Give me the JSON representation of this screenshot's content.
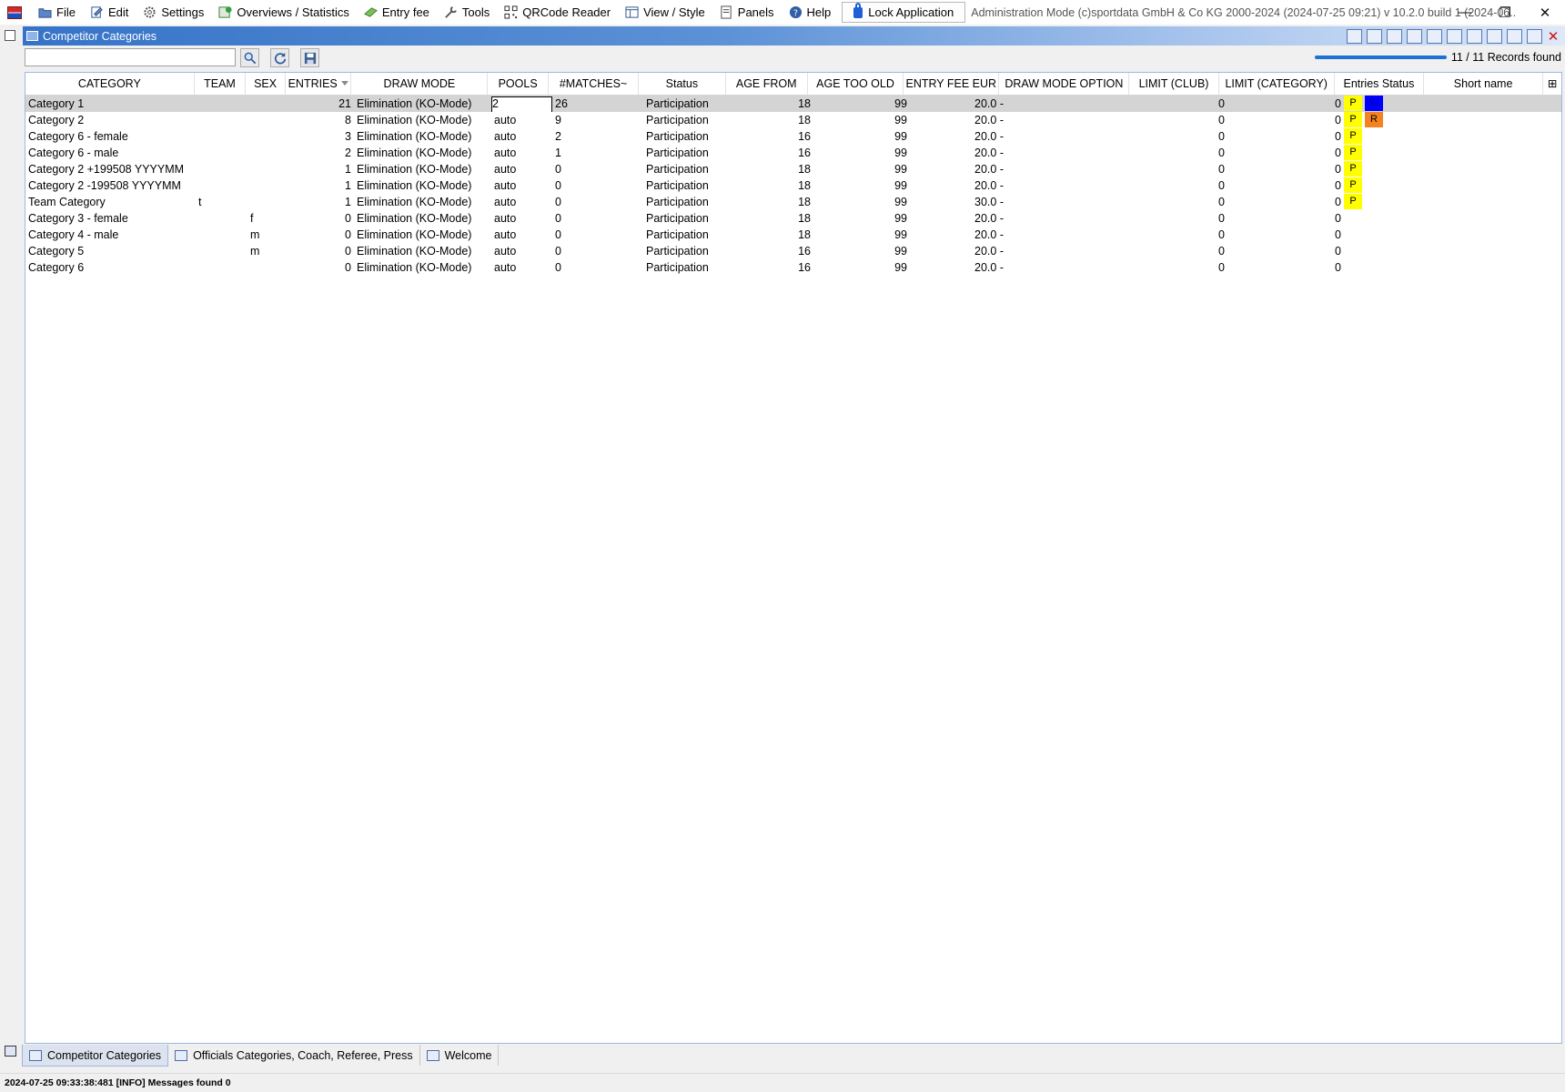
{
  "menubar": {
    "items": [
      {
        "label": "File",
        "icon": "folder-icon"
      },
      {
        "label": "Edit",
        "icon": "edit-icon"
      },
      {
        "label": "Settings",
        "icon": "gear-icon"
      },
      {
        "label": "Overviews / Statistics",
        "icon": "statistics-icon"
      },
      {
        "label": "Entry fee",
        "icon": "money-icon"
      },
      {
        "label": "Tools",
        "icon": "wrench-icon"
      },
      {
        "label": "QRCode Reader",
        "icon": "qrcode-icon"
      },
      {
        "label": "View / Style",
        "icon": "view-icon"
      },
      {
        "label": "Panels",
        "icon": "panels-icon"
      },
      {
        "label": "Help",
        "icon": "help-icon"
      }
    ],
    "lock_label": "Lock Application",
    "title": "Administration Mode (c)sportdata GmbH & Co KG 2000-2024 (2024-07-25 09:21)  v 10.2.0 build 1 (2024-06..."
  },
  "window_controls": {
    "minimize": "—",
    "restore": "❐",
    "close": "✕"
  },
  "panel": {
    "title": "Competitor Categories"
  },
  "toolbar": {
    "search_value": "",
    "progress_percent": 100,
    "records_found": "11 / 11 Records found"
  },
  "colors": {
    "yellow": "#ffff00",
    "blue": "#0000ff",
    "orange": "#f58220",
    "header_blue": "#3673c8"
  },
  "table": {
    "columns": [
      "CATEGORY",
      "TEAM",
      "SEX",
      "ENTRIES",
      "DRAW MODE",
      "POOLS",
      "#MATCHES~",
      "Status",
      "AGE FROM",
      "AGE TOO OLD",
      "ENTRY FEE EUR",
      "DRAW MODE OPTION",
      "LIMIT (CLUB)",
      "LIMIT (CATEGORY)",
      "Entries Status",
      "Short name"
    ],
    "rows": [
      {
        "category": "Category 1",
        "team": "",
        "sex": "",
        "entries": "21",
        "draw_mode": "Elimination (KO-Mode)",
        "pools": "2",
        "matches": "26",
        "status": "Participation",
        "age_from": "18",
        "age_too_old": "99",
        "entry_fee": "20.0 -",
        "draw_mode_option": "",
        "limit_club": "0",
        "limit_category": "0",
        "entries_status": [
          "P",
          "W"
        ],
        "short_name": ""
      },
      {
        "category": "Category 2",
        "team": "",
        "sex": "",
        "entries": "8",
        "draw_mode": "Elimination (KO-Mode)",
        "pools": "auto",
        "matches": "9",
        "status": "Participation",
        "age_from": "18",
        "age_too_old": "99",
        "entry_fee": "20.0 -",
        "draw_mode_option": "",
        "limit_club": "0",
        "limit_category": "0",
        "entries_status": [
          "P",
          "R"
        ],
        "short_name": ""
      },
      {
        "category": "Category 6 - female",
        "team": "",
        "sex": "",
        "entries": "3",
        "draw_mode": "Elimination (KO-Mode)",
        "pools": "auto",
        "matches": "2",
        "status": "Participation",
        "age_from": "16",
        "age_too_old": "99",
        "entry_fee": "20.0 -",
        "draw_mode_option": "",
        "limit_club": "0",
        "limit_category": "0",
        "entries_status": [
          "P"
        ],
        "short_name": ""
      },
      {
        "category": "Category 6 - male",
        "team": "",
        "sex": "",
        "entries": "2",
        "draw_mode": "Elimination (KO-Mode)",
        "pools": "auto",
        "matches": "1",
        "status": "Participation",
        "age_from": "16",
        "age_too_old": "99",
        "entry_fee": "20.0 -",
        "draw_mode_option": "",
        "limit_club": "0",
        "limit_category": "0",
        "entries_status": [
          "P"
        ],
        "short_name": ""
      },
      {
        "category": "Category 2 +199508 YYYYMM",
        "team": "",
        "sex": "",
        "entries": "1",
        "draw_mode": "Elimination (KO-Mode)",
        "pools": "auto",
        "matches": "0",
        "status": "Participation",
        "age_from": "18",
        "age_too_old": "99",
        "entry_fee": "20.0 -",
        "draw_mode_option": "",
        "limit_club": "0",
        "limit_category": "0",
        "entries_status": [
          "P"
        ],
        "short_name": ""
      },
      {
        "category": "Category 2 -199508 YYYYMM",
        "team": "",
        "sex": "",
        "entries": "1",
        "draw_mode": "Elimination (KO-Mode)",
        "pools": "auto",
        "matches": "0",
        "status": "Participation",
        "age_from": "18",
        "age_too_old": "99",
        "entry_fee": "20.0 -",
        "draw_mode_option": "",
        "limit_club": "0",
        "limit_category": "0",
        "entries_status": [
          "P"
        ],
        "short_name": ""
      },
      {
        "category": "Team Category",
        "team": "t",
        "sex": "",
        "entries": "1",
        "draw_mode": "Elimination (KO-Mode)",
        "pools": "auto",
        "matches": "0",
        "status": "Participation",
        "age_from": "18",
        "age_too_old": "99",
        "entry_fee": "30.0 -",
        "draw_mode_option": "",
        "limit_club": "0",
        "limit_category": "0",
        "entries_status": [
          "P"
        ],
        "short_name": ""
      },
      {
        "category": "Category 3 - female",
        "team": "",
        "sex": "f",
        "entries": "0",
        "draw_mode": "Elimination (KO-Mode)",
        "pools": "auto",
        "matches": "0",
        "status": "Participation",
        "age_from": "18",
        "age_too_old": "99",
        "entry_fee": "20.0 -",
        "draw_mode_option": "",
        "limit_club": "0",
        "limit_category": "0",
        "entries_status": [],
        "short_name": ""
      },
      {
        "category": "Category 4 - male",
        "team": "",
        "sex": "m",
        "entries": "0",
        "draw_mode": "Elimination (KO-Mode)",
        "pools": "auto",
        "matches": "0",
        "status": "Participation",
        "age_from": "18",
        "age_too_old": "99",
        "entry_fee": "20.0 -",
        "draw_mode_option": "",
        "limit_club": "0",
        "limit_category": "0",
        "entries_status": [],
        "short_name": ""
      },
      {
        "category": "Category 5",
        "team": "",
        "sex": "m",
        "entries": "0",
        "draw_mode": "Elimination (KO-Mode)",
        "pools": "auto",
        "matches": "0",
        "status": "Participation",
        "age_from": "16",
        "age_too_old": "99",
        "entry_fee": "20.0 -",
        "draw_mode_option": "",
        "limit_club": "0",
        "limit_category": "0",
        "entries_status": [],
        "short_name": ""
      },
      {
        "category": "Category 6",
        "team": "",
        "sex": "",
        "entries": "0",
        "draw_mode": "Elimination (KO-Mode)",
        "pools": "auto",
        "matches": "0",
        "status": "Participation",
        "age_from": "16",
        "age_too_old": "99",
        "entry_fee": "20.0 -",
        "draw_mode_option": "",
        "limit_club": "0",
        "limit_category": "0",
        "entries_status": [],
        "short_name": ""
      }
    ]
  },
  "bottom_tabs": [
    {
      "label": "Competitor Categories",
      "active": true
    },
    {
      "label": "Officials Categories, Coach, Referee, Press",
      "active": false
    },
    {
      "label": "Welcome",
      "active": false
    }
  ],
  "status_bar": {
    "message": "2024-07-25 09:33:38:481 [INFO] Messages found 0"
  }
}
